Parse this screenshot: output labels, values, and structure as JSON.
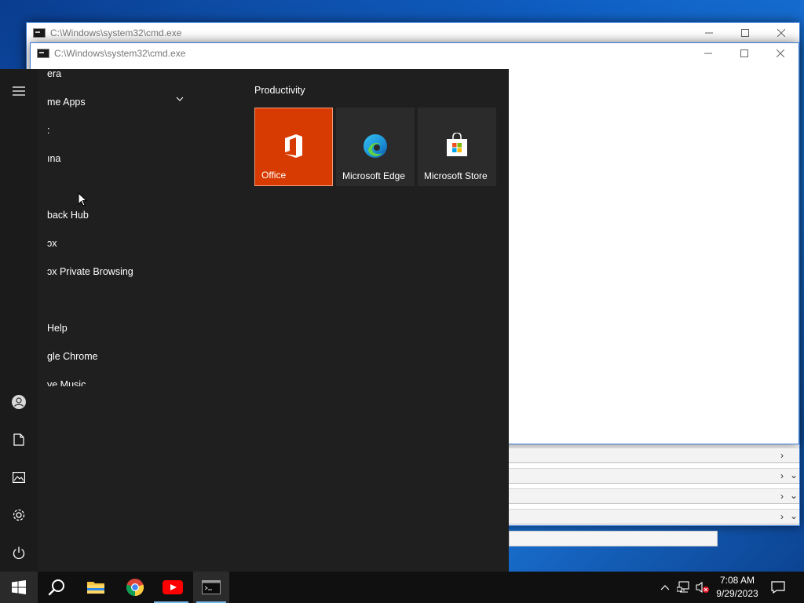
{
  "windows": [
    {
      "title": "C:\\Windows\\system32\\cmd.exe"
    },
    {
      "title": "C:\\Windows\\system32\\cmd.exe"
    }
  ],
  "start_menu": {
    "app_list": [
      {
        "label": "era"
      },
      {
        "label": "me Apps",
        "expandable": true
      },
      {
        "label": ":"
      },
      {
        "label": "ına"
      },
      {
        "label": ""
      },
      {
        "label": "back Hub"
      },
      {
        "label": "ɔx"
      },
      {
        "label": "ɔx Private Browsing"
      },
      {
        "label": ""
      },
      {
        "label": "Help"
      },
      {
        "label": "ɡle Chrome"
      },
      {
        "label": "ve Music"
      }
    ],
    "group_title": "Productivity",
    "tiles": [
      {
        "label": "Office",
        "icon": "office-icon",
        "color": "#d83b01"
      },
      {
        "label": "Microsoft Edge",
        "icon": "edge-icon",
        "color": "#2b2b2b"
      },
      {
        "label": "Microsoft Store",
        "icon": "store-icon",
        "color": "#2b2b2b"
      }
    ],
    "rail": [
      "menu-icon",
      "user-icon",
      "documents-icon",
      "pictures-icon",
      "settings-icon",
      "power-icon"
    ]
  },
  "taskbar": {
    "apps": [
      "start-icon",
      "search-icon",
      "file-explorer-icon",
      "chrome-icon",
      "youtube-icon",
      "cmd-icon"
    ],
    "time": "7:08 AM",
    "date": "9/29/2023"
  }
}
